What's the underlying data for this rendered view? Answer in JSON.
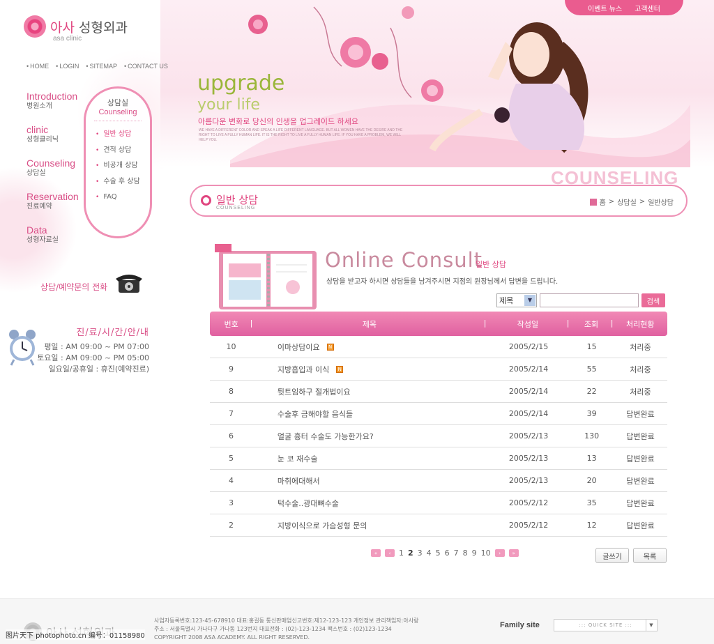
{
  "logo": {
    "brand_accent": "아사",
    "brand_rest": " 성형외과",
    "sub": "asa clinic"
  },
  "util_nav": [
    "HOME",
    "LOGIN",
    "SITEMAP",
    "CONTACT US"
  ],
  "side_menu": [
    {
      "en": "Introduction",
      "ko": "병원소개"
    },
    {
      "en": "clinic",
      "ko": "성형클리닉"
    },
    {
      "en": "Counseling",
      "ko": "상담실"
    },
    {
      "en": "Reservation",
      "ko": "진료예약"
    },
    {
      "en": "Data",
      "ko": "성형자료실"
    }
  ],
  "sub_panel": {
    "title_ko": "상담실",
    "title_en": "Counseling",
    "items": [
      "일반 상담",
      "견적 상담",
      "비공개 상담",
      "수술 후 상담",
      "FAQ"
    ]
  },
  "phone": {
    "title": "상담/예약문의 전화"
  },
  "hours": {
    "title": "진/료/시/간/안/내",
    "rows": [
      "평일 : AM 09:00 ~ PM 07:00",
      "토요일 : AM 09:00 ~ PM 05:00",
      "일요일/공휴일 : 휴진(예약진료)"
    ]
  },
  "top_tabs": [
    "이벤트 뉴스",
    "고객센터"
  ],
  "banner": {
    "headline": "upgrade",
    "headline2": "your life",
    "slogan": "아름다운 변화로 당신의 인생을 업그레이드 하세요",
    "small_copy": "WE HAVE A DIFFERENT COLOR AND SPEAK A LIFE DIFFERENT LANGUAGE. BUT ALL WOMEN HAVE THE DESIRE AND THE RIGHT TO LIVE A FULLY HUMAN LIFE. IT IS THE RIGHT TO LIVE A FULLY HUMAN LIFE. IF YOU HAVE A PROBLEM, WE WILL HELP YOU."
  },
  "section_big": "COUNSELING",
  "title_bar": {
    "ko": "일반 상담",
    "en": "COUNSELING",
    "crumbs": [
      "홈",
      "상담실",
      "일반상담"
    ]
  },
  "consult": {
    "title": "Online Consult",
    "sub": "일반 상담",
    "desc": "상담을 받고자 하시면 상담들을 남겨주시면 지점의 원장님께서 답변을 드립니다."
  },
  "search": {
    "select_value": "제목",
    "button": "검색"
  },
  "table": {
    "headers": [
      "번호",
      "제목",
      "작성일",
      "조회",
      "처리현황"
    ],
    "rows": [
      {
        "no": "10",
        "title": "이마상담이요",
        "date": "2005/2/15",
        "views": "15",
        "status": "처리중",
        "new": true
      },
      {
        "no": "9",
        "title": "지방흡입과 이식",
        "date": "2005/2/14",
        "views": "55",
        "status": "처리중",
        "new": true
      },
      {
        "no": "8",
        "title": "튓트임하구 절개법이요",
        "date": "2005/2/14",
        "views": "22",
        "status": "처리중",
        "new": false
      },
      {
        "no": "7",
        "title": "수술후 금해야할 음식들",
        "date": "2005/2/14",
        "views": "39",
        "status": "답변완료",
        "new": false
      },
      {
        "no": "6",
        "title": "얼굴 흉터 수술도 가능한가요?",
        "date": "2005/2/13",
        "views": "130",
        "status": "답변완료",
        "new": false
      },
      {
        "no": "5",
        "title": "눈 코 재수술",
        "date": "2005/2/13",
        "views": "13",
        "status": "답변완료",
        "new": false
      },
      {
        "no": "4",
        "title": "마취에대해서",
        "date": "2005/2/13",
        "views": "20",
        "status": "답변완료",
        "new": false
      },
      {
        "no": "3",
        "title": "턱수술..광대뼈수술",
        "date": "2005/2/12",
        "views": "35",
        "status": "답변완료",
        "new": false
      },
      {
        "no": "2",
        "title": "지방이식으로 가슴성형 문의",
        "date": "2005/2/12",
        "views": "12",
        "status": "답변완료",
        "new": false
      }
    ]
  },
  "pager": {
    "pages": [
      "1",
      "2",
      "3",
      "4",
      "5",
      "6",
      "7",
      "8",
      "9",
      "10"
    ],
    "current": "2"
  },
  "actions": {
    "write": "글쓰기",
    "list": "목록"
  },
  "footer": {
    "logo": "아사 성형외과",
    "lines": [
      "사업자등록번호:123-45-678910   대표:홍길동   통신판매업신고번호:제12-123-123   개인정보 관리책임자:아사랑",
      "주소 : 서울특별시 가나다구 가나동 123번지   대표전화 : (02)-123-1234   팩스번호 : (02)123-1234",
      "COPYRIGHT 2008 ASA ACADEMY. ALL RIGHT RESERVED."
    ],
    "watermark": "图片天下 photophoto.cn 编号：01158980",
    "family_label": "Family site",
    "family_select": "::: QUICK SITE :::"
  },
  "colors": {
    "accent": "#e0457f",
    "pink_bar": "#e866a0",
    "green": "#9ab63a"
  }
}
